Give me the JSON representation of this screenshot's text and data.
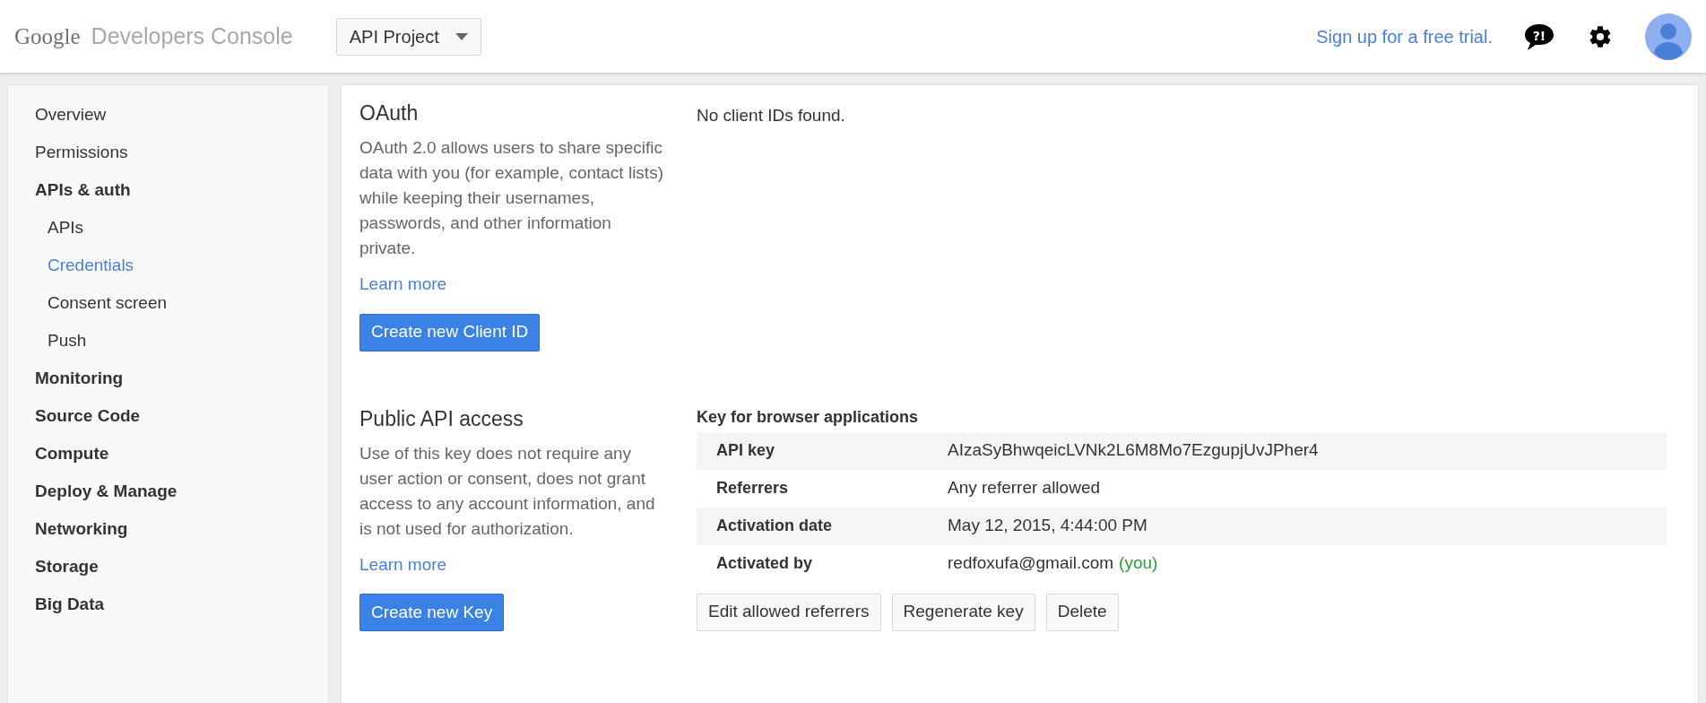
{
  "header": {
    "logo": "Google",
    "product": "Developers Console",
    "project": "API Project",
    "signup_link": "Sign up for a free trial.",
    "help_icon_text": "?!"
  },
  "sidebar": {
    "items": [
      {
        "label": "Overview",
        "kind": "page",
        "selected": false
      },
      {
        "label": "Permissions",
        "kind": "page",
        "selected": false
      },
      {
        "label": "APIs & auth",
        "kind": "group",
        "selected": false,
        "children": [
          {
            "label": "APIs",
            "selected": false
          },
          {
            "label": "Credentials",
            "selected": true
          },
          {
            "label": "Consent screen",
            "selected": false
          },
          {
            "label": "Push",
            "selected": false
          }
        ]
      },
      {
        "label": "Monitoring",
        "kind": "group",
        "selected": false
      },
      {
        "label": "Source Code",
        "kind": "group",
        "selected": false
      },
      {
        "label": "Compute",
        "kind": "group",
        "selected": false
      },
      {
        "label": "Deploy & Manage",
        "kind": "group",
        "selected": false
      },
      {
        "label": "Networking",
        "kind": "group",
        "selected": false
      },
      {
        "label": "Storage",
        "kind": "group",
        "selected": false
      },
      {
        "label": "Big Data",
        "kind": "group",
        "selected": false
      }
    ]
  },
  "sections": [
    {
      "title": "OAuth",
      "description": "OAuth 2.0 allows users to share specific data with you (for example, contact lists) while keeping their usernames, passwords, and other information private.",
      "learn_more": "Learn more",
      "button": "Create new Client ID",
      "empty_message": "No client IDs found."
    },
    {
      "title": "Public API access",
      "description": "Use of this key does not require any user action or consent, does not grant access to any account information, and is not used for authorization.",
      "learn_more": "Learn more",
      "button": "Create new Key",
      "key": {
        "title": "Key for browser applications",
        "rows": [
          {
            "label": "API key",
            "value": "AIzaSyBhwqeicLVNk2L6M8Mo7EzgupjUvJPher4"
          },
          {
            "label": "Referrers",
            "value": "Any referrer allowed"
          },
          {
            "label": "Activation date",
            "value": "May 12, 2015, 4:44:00 PM"
          },
          {
            "label": "Activated by",
            "value": "redfoxufa@gmail.com",
            "note": "(you)"
          }
        ],
        "actions": [
          "Edit allowed referrers",
          "Regenerate key",
          "Delete"
        ]
      }
    }
  ]
}
